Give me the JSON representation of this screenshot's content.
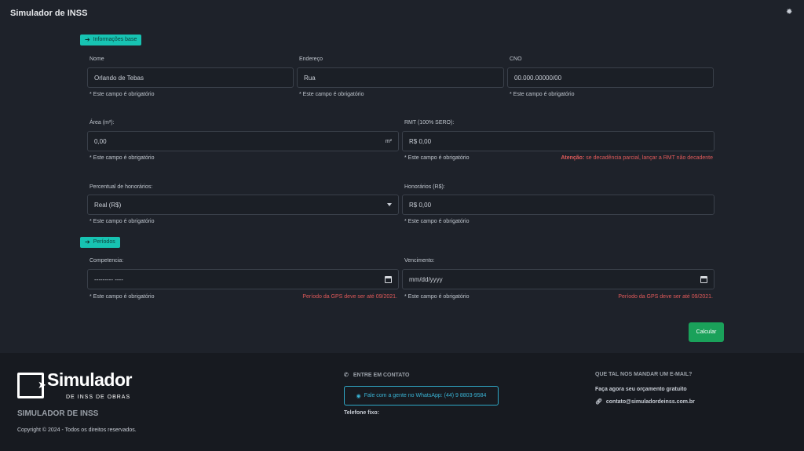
{
  "header": {
    "title": "Simulador de INSS",
    "settings_icon": "gear-icon"
  },
  "sections": {
    "base": "Informações base",
    "periods": "Períodos"
  },
  "fields": {
    "nome": {
      "label": "Nome",
      "value": "Orlando de Tebas",
      "help": "* Este campo é obrigatório"
    },
    "endereco": {
      "label": "Endereço",
      "value": "Rua",
      "help": "* Este campo é obrigatório"
    },
    "cno": {
      "label": "CNO",
      "value": "00.000.00000/00",
      "help": "* Este campo é obrigatório"
    },
    "area": {
      "label": "Área (m²):",
      "value": "0,00",
      "suffix": "m²",
      "help": "* Este campo é obrigatório"
    },
    "rmt": {
      "label": "RMT (100% SERO):",
      "value": "R$ 0,00",
      "help": "* Este campo é obrigatório",
      "warning_strong": "Atenção:",
      "warning_text": " se decadência parcial, lançar a RMT não decadente"
    },
    "percentual": {
      "label": "Percentual de honorários:",
      "value": "Real (R$)",
      "help": "* Este campo é obrigatório"
    },
    "honorarios": {
      "label": "Honorários (R$):",
      "value": "R$ 0,00",
      "help": "* Este campo é obrigatório"
    },
    "competencia": {
      "label": "Competencia:",
      "value": "--------- ----",
      "help": "* Este campo é obrigatório",
      "warning": "Período da GPS deve ser até 09/2021."
    },
    "vencimento": {
      "label": "Vencimento:",
      "value": "mm/dd/yyyy",
      "help": "* Este campo é obrigatório",
      "warning": "Período da GPS deve ser até 09/2021."
    }
  },
  "actions": {
    "calculate": "Calcular"
  },
  "footer": {
    "logo_word": "Simulador",
    "logo_sub": "DE INSS DE OBRAS",
    "brand": "SIMULADOR DE INSS",
    "copyright": "Copyright © 2024 - Todos os direitos reservados.",
    "contact_heading": "ENTRE EM CONTATO",
    "whatsapp": "Fale com a gente no WhatsApp: (44) 9 8803-9584",
    "phone_label": "Telefone fixo:",
    "email_heading": "QUE TAL NOS MANDAR UM E-MAIL?",
    "email_sub": "Faça agora seu orçamento gratuito",
    "email": "contato@simuladordeinss.com.br"
  },
  "colors": {
    "accent": "#17c3b2",
    "button": "#1aa15a",
    "warning": "#e05a5a",
    "link": "#39b3d4"
  }
}
